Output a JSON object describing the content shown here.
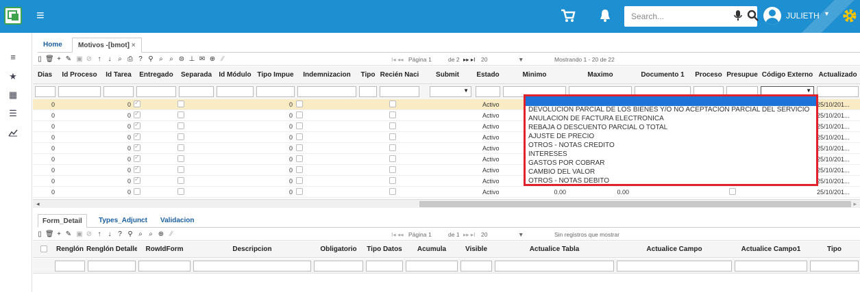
{
  "header": {
    "search_placeholder": "Search...",
    "user_name": "JULIETH"
  },
  "tabs": [
    {
      "label": "Home"
    },
    {
      "label": "Motivos -[bmot]"
    }
  ],
  "tab_close": "×",
  "toolbar": {
    "pager_first": "I◂ ◂◂",
    "page_label": "Página",
    "page_value": "1",
    "page_of": "de 2",
    "pager_next": "▸▸ ▸I",
    "page_size": "20",
    "record_info": "Mostrando 1 - 20 de 22"
  },
  "grid": {
    "columns": [
      "Dias",
      "Id Proceso",
      "Id Tarea",
      "Entregado",
      "Separada",
      "Id Módulo",
      "Tipo Impue",
      "Indemnizacion",
      "Tipo",
      "Recién Naci",
      "Submit",
      "Estado",
      "Minimo",
      "Maximo",
      "Documento 1",
      "Proceso",
      "Presupue",
      "Código Externo",
      "Actualizado"
    ],
    "rows": [
      {
        "dias": "0",
        "id_tarea": "0",
        "entregado": true,
        "tipo_impue": "0",
        "estado": "Activo",
        "minimo": "",
        "maximo": "",
        "actualizado": "25/10/201..."
      },
      {
        "dias": "0",
        "id_tarea": "0",
        "entregado": true,
        "tipo_impue": "0",
        "estado": "Activo",
        "minimo": "",
        "maximo": "",
        "actualizado": "25/10/201..."
      },
      {
        "dias": "0",
        "id_tarea": "0",
        "entregado": true,
        "tipo_impue": "0",
        "estado": "Activo",
        "minimo": "",
        "maximo": "",
        "actualizado": "25/10/201..."
      },
      {
        "dias": "0",
        "id_tarea": "0",
        "entregado": true,
        "tipo_impue": "0",
        "estado": "Activo",
        "minimo": "",
        "maximo": "",
        "actualizado": "25/10/201..."
      },
      {
        "dias": "0",
        "id_tarea": "0",
        "entregado": true,
        "tipo_impue": "0",
        "estado": "Activo",
        "minimo": "",
        "maximo": "",
        "actualizado": "25/10/201..."
      },
      {
        "dias": "0",
        "id_tarea": "0",
        "entregado": true,
        "tipo_impue": "0",
        "estado": "Activo",
        "minimo": "",
        "maximo": "",
        "actualizado": "25/10/201..."
      },
      {
        "dias": "0",
        "id_tarea": "0",
        "entregado": true,
        "tipo_impue": "0",
        "estado": "Activo",
        "minimo": "",
        "maximo": "",
        "actualizado": "25/10/201..."
      },
      {
        "dias": "0",
        "id_tarea": "0",
        "entregado": true,
        "tipo_impue": "0",
        "estado": "Activo",
        "minimo": "",
        "maximo": "",
        "actualizado": "25/10/201..."
      },
      {
        "dias": "0",
        "id_tarea": "0",
        "entregado": false,
        "tipo_impue": "0",
        "estado": "Activo",
        "minimo": "0.00",
        "maximo": "0.00",
        "actualizado": "25/10/201..."
      }
    ]
  },
  "dropdown": {
    "options": [
      "DEVOLUCION PARCIAL DE LOS BIENES Y/O NO ACEPTACION PARCIAL DEL SERVICIO",
      "ANULACION DE FACTURA ELECTRONICA",
      "REBAJA O DESCUENTO PARCIAL O TOTAL",
      "AJUSTE DE PRECIO",
      "OTROS - NOTAS CREDITO",
      "INTERESES",
      "GASTOS POR COBRAR",
      "CAMBIO DEL VALOR",
      "OTROS - NOTAS DEBITO"
    ]
  },
  "detail": {
    "tabs": [
      "Form_Detail",
      "Types_Adjunct",
      "Validacion"
    ],
    "toolbar": {
      "pager_first": "I◂ ◂◂",
      "page_label": "Página",
      "page_value": "1",
      "page_of": "de 1",
      "pager_next": "▸▸ ▸I",
      "page_size": "20",
      "record_info": "Sin registros que mostrar"
    },
    "columns": [
      "Renglón",
      "Renglón Detalle",
      "RowIdForm",
      "Descripcion",
      "Obligatorio",
      "Tipo Datos",
      "Acumula",
      "Visible",
      "Actualice Tabla",
      "Actualice Campo",
      "Actualice Campo1",
      "Tipo"
    ]
  },
  "colors": {
    "topbar": "#1e8fd0",
    "dropdown_border": "#e0202a",
    "selected_row": "#f9ebc4"
  }
}
